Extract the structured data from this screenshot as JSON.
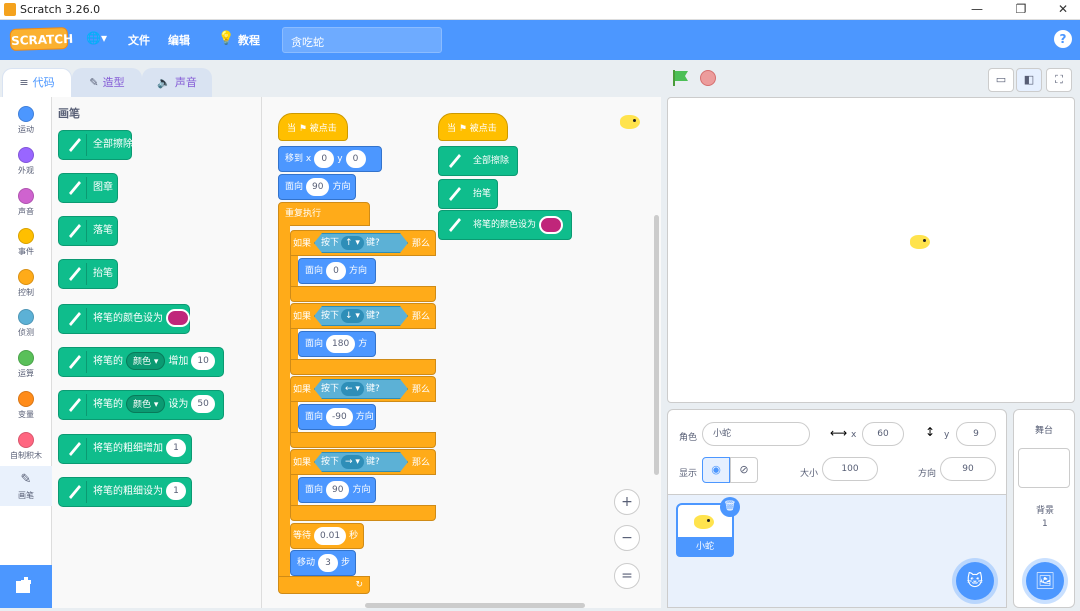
{
  "window": {
    "title": "Scratch 3.26.0",
    "minimize": "—",
    "restore": "❐",
    "close": "✕"
  },
  "menu": {
    "logo": "SCRATCH",
    "globe": "🌐▾",
    "file": "文件",
    "edit": "编辑",
    "tutorials": "教程",
    "project_title": "贪吃蛇",
    "help": "?"
  },
  "tabs": [
    {
      "label": "代码"
    },
    {
      "label": "造型"
    },
    {
      "label": "声音"
    }
  ],
  "categories": [
    {
      "label": "运动",
      "color": "#4c97ff"
    },
    {
      "label": "外观",
      "color": "#9966ff"
    },
    {
      "label": "声音",
      "color": "#cf63cf"
    },
    {
      "label": "事件",
      "color": "#ffbf00"
    },
    {
      "label": "控制",
      "color": "#ffab19"
    },
    {
      "label": "侦测",
      "color": "#5cb1d6"
    },
    {
      "label": "运算",
      "color": "#59c059"
    },
    {
      "label": "变量",
      "color": "#ff8c1a"
    },
    {
      "label": "自制积木",
      "color": "#ff6680"
    },
    {
      "label": "画笔",
      "color": "#0fbd8c"
    }
  ],
  "palette": {
    "title": "画笔",
    "blocks": [
      {
        "text": "全部擦除"
      },
      {
        "text": "图章"
      },
      {
        "text": "落笔"
      },
      {
        "text": "抬笔"
      },
      {
        "text": "将笔的颜色设为"
      },
      {
        "pre": "将笔的",
        "drop": "颜色 ▾",
        "mid": "增加",
        "val": "10"
      },
      {
        "pre": "将笔的",
        "drop": "颜色 ▾",
        "mid": "设为",
        "val": "50"
      },
      {
        "pre": "将笔的粗细增加",
        "val": "1"
      },
      {
        "pre": "将笔的粗细设为",
        "val": "1"
      }
    ]
  },
  "script1": {
    "hat": "当 ⚑ 被点击",
    "goto": {
      "label": "移到 x",
      "x": "0",
      "ylabel": "y",
      "y": "0"
    },
    "point": {
      "label": "面向",
      "val": "90",
      "suffix": "方向"
    },
    "forever": "重复执行",
    "ifs": [
      {
        "if": "如果",
        "press": "按下",
        "key": "↑ ▾",
        "keylbl": "键?",
        "then": "那么",
        "point": "面向",
        "val": "0",
        "dir": "方向"
      },
      {
        "if": "如果",
        "press": "按下",
        "key": "↓ ▾",
        "keylbl": "键?",
        "then": "那么",
        "point": "面向",
        "val": "180",
        "dir": "方向"
      },
      {
        "if": "如果",
        "press": "按下",
        "key": "← ▾",
        "keylbl": "键?",
        "then": "那么",
        "point": "面向",
        "val": "-90",
        "dir": "方向"
      },
      {
        "if": "如果",
        "press": "按下",
        "key": "→ ▾",
        "keylbl": "键?",
        "then": "那么",
        "point": "面向",
        "val": "90",
        "dir": "方向"
      }
    ],
    "wait": {
      "label": "等待",
      "val": "0.01",
      "suffix": "秒"
    },
    "move": {
      "label": "移动",
      "val": "3",
      "suffix": "步"
    },
    "loop_arrow": "↻"
  },
  "script2": {
    "hat": "当 ⚑ 被点击",
    "clear": "全部擦除",
    "penup": "抬笔",
    "setcolor": "将笔的颜色设为"
  },
  "zoom": {
    "in": "+",
    "out": "−",
    "reset": "="
  },
  "sprite": {
    "name_label": "角色",
    "name": "小蛇",
    "x_label": "x",
    "x": "60",
    "y_label": "y",
    "y": "9",
    "show_label": "显示",
    "size_label": "大小",
    "size": "100",
    "dir_label": "方向",
    "dir": "90",
    "thumb_label": "小蛇"
  },
  "stage_panel": {
    "title": "舞台",
    "backdrops_label": "背景",
    "backdrops": "1"
  },
  "colors": {
    "accent": "#4c97ff",
    "pen": "#0fbd8c",
    "events": "#ffbf00",
    "control": "#ffab19",
    "sensing": "#5cb1d6",
    "pen_color": "#c0267a"
  }
}
